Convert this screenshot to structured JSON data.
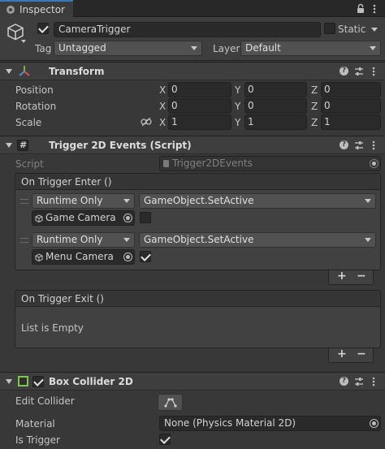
{
  "tab": {
    "title": "Inspector"
  },
  "header": {
    "object_name": "CameraTrigger",
    "active_checked": true,
    "static_label": "Static",
    "static_checked": false,
    "tag_label": "Tag",
    "tag_value": "Untagged",
    "layer_label": "Layer",
    "layer_value": "Default"
  },
  "transform": {
    "title": "Transform",
    "rows": [
      {
        "label": "Position",
        "x": "0",
        "y": "0",
        "z": "0"
      },
      {
        "label": "Rotation",
        "x": "0",
        "y": "0",
        "z": "0"
      },
      {
        "label": "Scale",
        "x": "1",
        "y": "1",
        "z": "1"
      }
    ],
    "axis_labels": {
      "x": "X",
      "y": "Y",
      "z": "Z"
    }
  },
  "trigger_events": {
    "title": "Trigger 2D Events (Script)",
    "script_label": "Script",
    "script_value": "Trigger2DEvents",
    "enter": {
      "title": "On Trigger Enter ()",
      "entries": [
        {
          "mode": "Runtime Only",
          "function": "GameObject.SetActive",
          "target": "Game Camera",
          "checked": false
        },
        {
          "mode": "Runtime Only",
          "function": "GameObject.SetActive",
          "target": "Menu Camera",
          "checked": true
        }
      ]
    },
    "exit": {
      "title": "On Trigger Exit ()",
      "empty_text": "List is Empty"
    },
    "plus_label": "+",
    "minus_label": "−"
  },
  "box_collider": {
    "title": "Box Collider 2D",
    "enabled": true,
    "edit_collider_label": "Edit Collider",
    "material_label": "Material",
    "material_value": "None (Physics Material 2D)",
    "is_trigger_label": "Is Trigger",
    "is_trigger_checked": true
  },
  "colors": {
    "background": "#383838",
    "header": "#3e3e3e",
    "field": "#2a2a2a",
    "accent": "#3a79bb"
  }
}
